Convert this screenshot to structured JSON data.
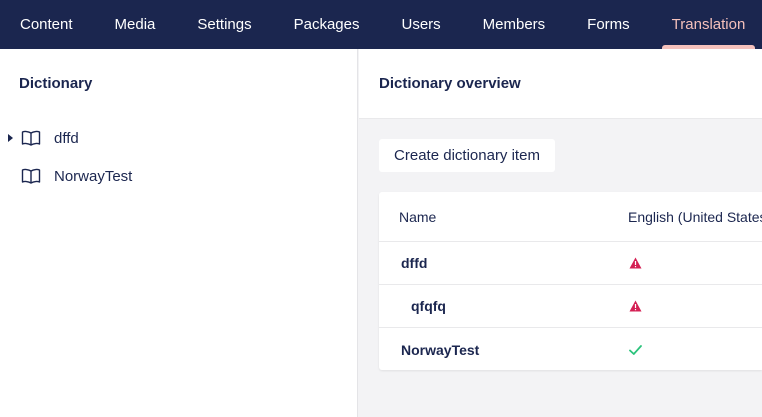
{
  "nav": {
    "items": [
      {
        "label": "Content"
      },
      {
        "label": "Media"
      },
      {
        "label": "Settings"
      },
      {
        "label": "Packages"
      },
      {
        "label": "Users"
      },
      {
        "label": "Members"
      },
      {
        "label": "Forms"
      },
      {
        "label": "Translation"
      }
    ],
    "active": "Translation"
  },
  "sidebar": {
    "title": "Dictionary",
    "items": [
      {
        "label": "dffd",
        "expandable": true
      },
      {
        "label": "NorwayTest",
        "expandable": false
      }
    ]
  },
  "main": {
    "title": "Dictionary overview",
    "create_button": "Create dictionary item",
    "table": {
      "headers": [
        "Name",
        "English (United States"
      ],
      "rows": [
        {
          "name": "dffd",
          "status": "warning-icon"
        },
        {
          "name": "qfqfq",
          "status": "warning-icon"
        },
        {
          "name": "NorwayTest",
          "status": "check-icon"
        }
      ]
    }
  },
  "colors": {
    "nav_bg": "#1b264f",
    "active_accent": "#f5c1bc",
    "warning": "#d42054",
    "success": "#2bc37c"
  }
}
